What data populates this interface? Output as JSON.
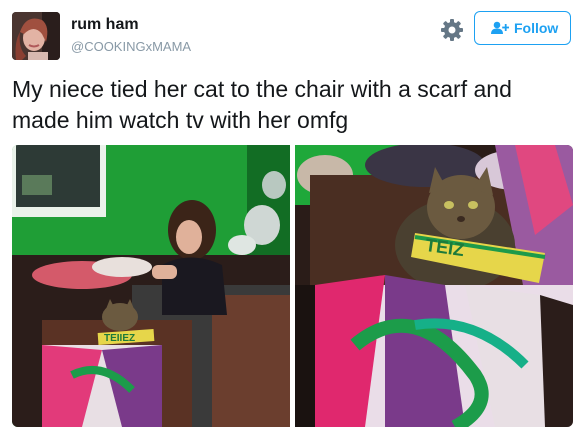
{
  "user": {
    "display_name": "rum ham",
    "handle": "@COOKINGxMAMA",
    "avatar_icon": "profile-photo"
  },
  "actions": {
    "settings_icon": "gear-icon",
    "follow_label": "Follow",
    "follow_icon": "add-user-icon"
  },
  "tweet": {
    "text": "My niece tied her cat to the chair with a scarf and made him watch tv with her omfg"
  },
  "media": {
    "scarf_text_left": "TEIIEZ",
    "scarf_text_right": "TEIZ"
  },
  "colors": {
    "accent": "#1da1f2",
    "text": "#14171a",
    "muted": "#8899a6",
    "wall_green": "#1fa83a"
  }
}
